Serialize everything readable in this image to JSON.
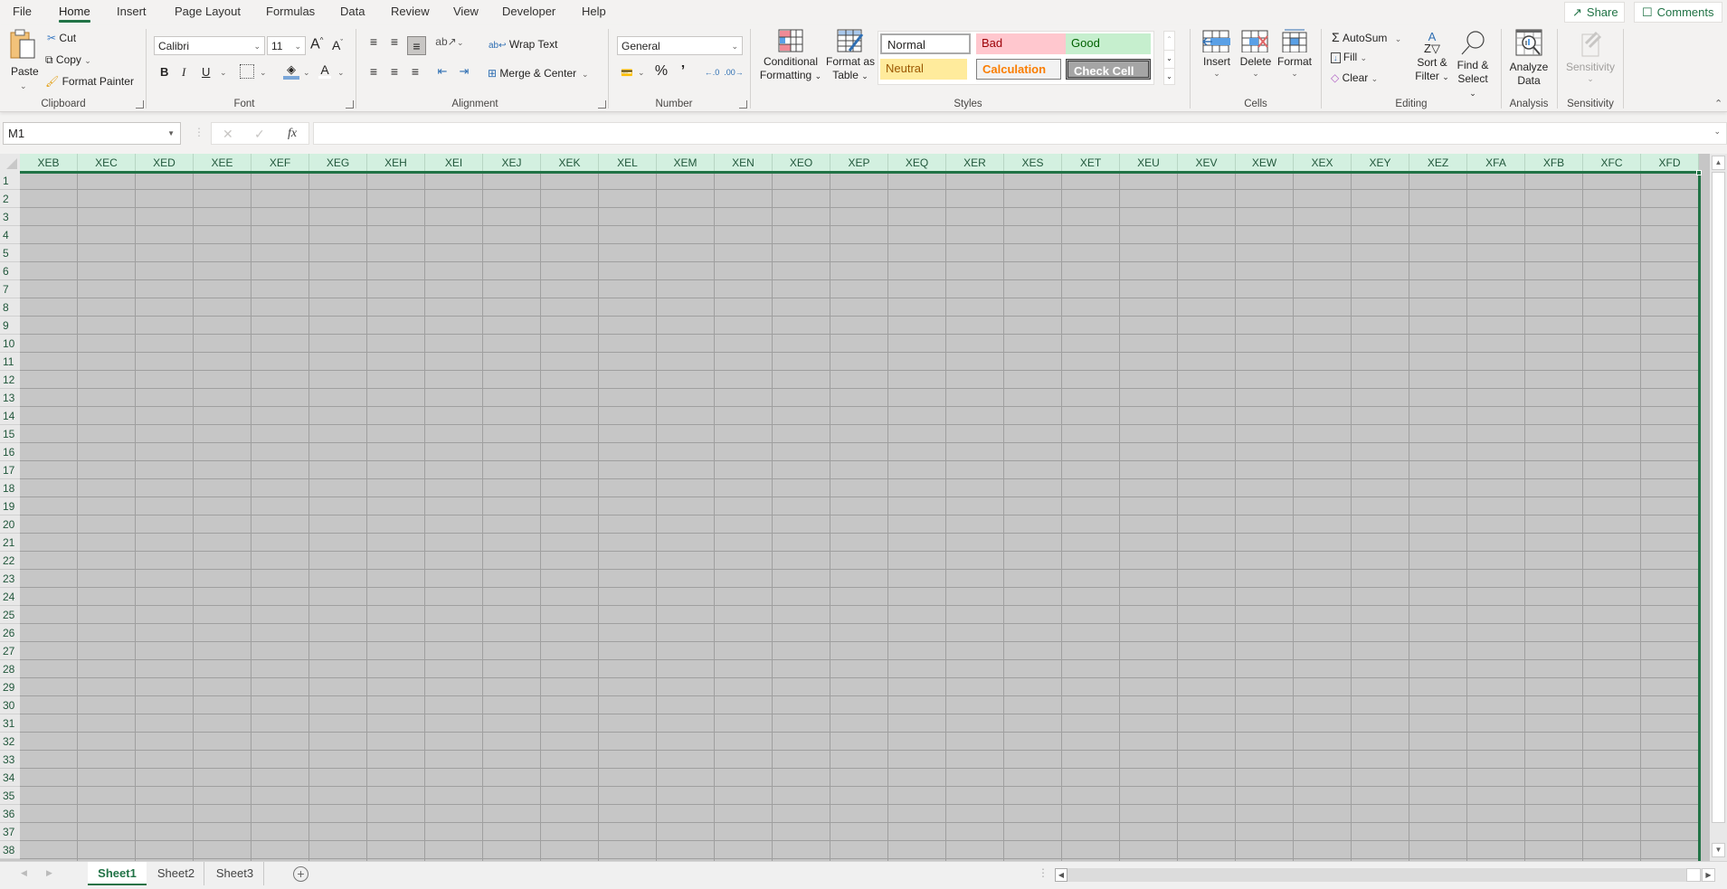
{
  "menu": {
    "tabs": [
      {
        "label": "File"
      },
      {
        "label": "Home",
        "active": true
      },
      {
        "label": "Insert"
      },
      {
        "label": "Page Layout"
      },
      {
        "label": "Formulas"
      },
      {
        "label": "Data"
      },
      {
        "label": "Review"
      },
      {
        "label": "View"
      },
      {
        "label": "Developer"
      },
      {
        "label": "Help"
      }
    ],
    "share_label": "Share",
    "comments_label": "Comments"
  },
  "ribbon": {
    "clipboard": {
      "label": "Clipboard",
      "paste": "Paste",
      "cut": "Cut",
      "copy": "Copy",
      "format_painter": "Format Painter"
    },
    "font": {
      "label": "Font",
      "font_name": "Calibri",
      "font_size": "11",
      "bold": "B",
      "italic": "I",
      "underline": "U"
    },
    "alignment": {
      "label": "Alignment",
      "wrap_text": "Wrap Text",
      "merge_center": "Merge & Center"
    },
    "number": {
      "label": "Number",
      "format": "General"
    },
    "styles": {
      "label": "Styles",
      "conditional_formatting": [
        "Conditional",
        "Formatting"
      ],
      "format_as_table": [
        "Format as",
        "Table"
      ],
      "cell_styles": [
        {
          "name": "Normal",
          "bg": "#ffffff",
          "fg": "#000000"
        },
        {
          "name": "Bad",
          "bg": "#ffc7ce",
          "fg": "#9c0006"
        },
        {
          "name": "Good",
          "bg": "#c6efce",
          "fg": "#006100"
        },
        {
          "name": "Neutral",
          "bg": "#ffeb9c",
          "fg": "#9c5700"
        },
        {
          "name": "Calculation",
          "bg": "#f2f2f2",
          "fg": "#fa7d00"
        },
        {
          "name": "Check Cell",
          "bg": "#a5a5a5",
          "fg": "#ffffff"
        }
      ]
    },
    "cells": {
      "label": "Cells",
      "insert": "Insert",
      "delete": "Delete",
      "format": "Format"
    },
    "editing": {
      "label": "Editing",
      "autosum": "AutoSum",
      "fill": "Fill",
      "clear": "Clear",
      "sort_filter": [
        "Sort &",
        "Filter"
      ],
      "find_select": [
        "Find &",
        "Select"
      ]
    },
    "analysis": {
      "label": "Analysis",
      "analyze_data": [
        "Analyze",
        "Data"
      ]
    },
    "sensitivity": {
      "label": "Sensitivity",
      "button": "Sensitivity"
    }
  },
  "formula_bar": {
    "name_box": "M1",
    "cancel_icon": "✕",
    "enter_icon": "✓",
    "fx": "fx",
    "formula": ""
  },
  "grid": {
    "columns": [
      "XEB",
      "XEC",
      "XED",
      "XEE",
      "XEF",
      "XEG",
      "XEH",
      "XEI",
      "XEJ",
      "XEK",
      "XEL",
      "XEM",
      "XEN",
      "XEO",
      "XEP",
      "XEQ",
      "XER",
      "XES",
      "XET",
      "XEU",
      "XEV",
      "XEW",
      "XEX",
      "XEY",
      "XEZ",
      "XFA",
      "XFB",
      "XFC",
      "XFD"
    ],
    "rows": [
      "1",
      "2",
      "3",
      "4",
      "5",
      "6",
      "7",
      "8",
      "9",
      "10",
      "11",
      "12",
      "13",
      "14",
      "15",
      "16",
      "17",
      "18",
      "19",
      "20",
      "21",
      "22",
      "23",
      "24",
      "25",
      "26",
      "27",
      "28",
      "29",
      "30",
      "31",
      "32",
      "33",
      "34",
      "35",
      "36",
      "37",
      "38"
    ]
  },
  "sheets": [
    {
      "label": "Sheet1",
      "active": true
    },
    {
      "label": "Sheet2"
    },
    {
      "label": "Sheet3"
    }
  ],
  "colors": {
    "accent": "#217346",
    "header_selected": "#d3f0e0",
    "cell_selected": "#c6c6c6"
  }
}
